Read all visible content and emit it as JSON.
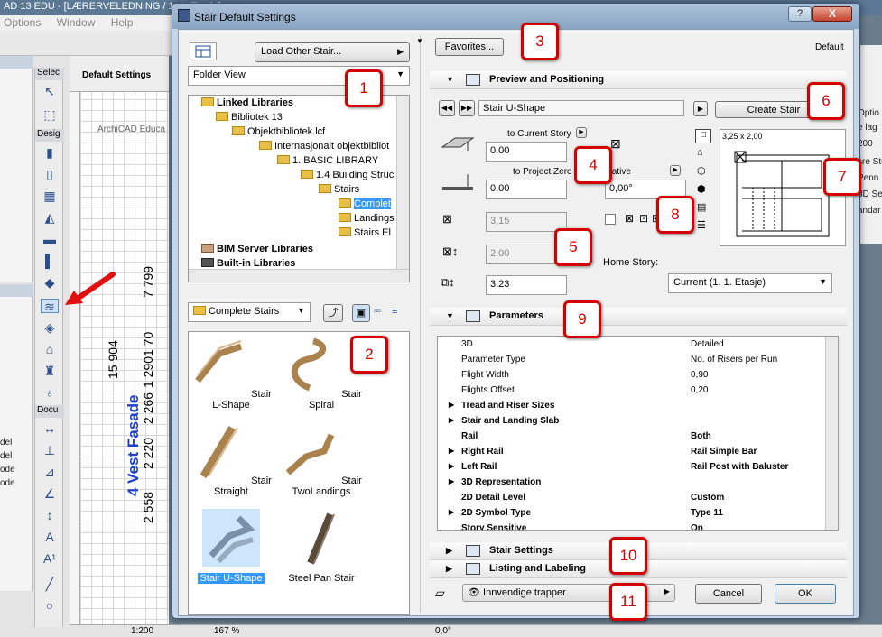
{
  "app": {
    "title": "AD 13 EDU - [LÆRERVELEDNING / 1. 1. Etasje]",
    "menu": [
      "Options",
      "Window",
      "Help"
    ],
    "toolbox_heads": [
      "Selec",
      "Desig",
      "Docu"
    ],
    "tab_label": "Default Settings",
    "tab_sub": "ArchiCAD Educa",
    "dims": [
      "7 799",
      "15 904",
      "2 558",
      "2 220",
      "2 266",
      "1 290",
      "1 70"
    ],
    "fasade": "4 Vest Fasade",
    "left_side": [
      "del",
      "del",
      "ode",
      "ode"
    ],
    "right_strip": [
      "Optio",
      "e lag",
      "200",
      "sre Stu",
      "Penn",
      "3D Se",
      "andar"
    ],
    "status": {
      "scale": "1:200",
      "zoom": "167 %",
      "angle": "0,0°"
    }
  },
  "dialog": {
    "title": "Stair Default Settings",
    "help": "?",
    "close": "X",
    "load_other": "Load Other Stair...",
    "folder_view": "Folder View",
    "favorites": "Favorites...",
    "default_label": "Default",
    "tree": {
      "linked": "Linked Libraries",
      "bib13": "Bibliotek 13",
      "obj": "Objektbibliotek.lcf",
      "intl": "Internasjonalt objektbibliot",
      "basic": "1. BASIC LIBRARY",
      "building": "1.4 Building Struc",
      "stairs": "Stairs",
      "complete": "Complet",
      "landings": "Landings",
      "stairs_el": "Stairs El",
      "bim": "BIM Server Libraries",
      "builtin": "Built-in Libraries"
    },
    "folder_select": "Complete Stairs",
    "gallery": [
      "Stair L-Shape",
      "Stair Spiral",
      "Stair Straight",
      "Stair TwoLandings",
      "Stair U-Shape",
      "Steel Pan Stair"
    ],
    "preview": {
      "title": "Preview and Positioning",
      "stair_name": "Stair U-Shape",
      "create_stair": "Create Stair",
      "to_current": "to Current Story",
      "val_current": "0,00",
      "to_project": "to Project Zero",
      "val_project": "0,00",
      "relative": "elative",
      "angle": "0,00°",
      "w": "3,15",
      "l": "2,00",
      "h": "3,23",
      "size_label": "3,25 x 2,00",
      "home_story_label": "Home Story:",
      "home_story": "Current (1. 1. Etasje)"
    },
    "parameters": {
      "title": "Parameters",
      "rows": [
        {
          "k": "3D",
          "v": "Detailed",
          "b": false,
          "t": false
        },
        {
          "k": "Parameter Type",
          "v": "No. of Risers per Run",
          "b": false,
          "t": false
        },
        {
          "k": "Flight Width",
          "v": "0,90",
          "b": false,
          "t": false
        },
        {
          "k": "Flights Offset",
          "v": "0,20",
          "b": false,
          "t": false
        },
        {
          "k": "Tread and Riser Sizes",
          "v": "",
          "b": true,
          "t": true
        },
        {
          "k": "Stair and Landing Slab",
          "v": "",
          "b": true,
          "t": true
        },
        {
          "k": "Rail",
          "v": "Both",
          "b": true,
          "t": false
        },
        {
          "k": "Right Rail",
          "v": "Rail Simple Bar",
          "b": true,
          "t": true
        },
        {
          "k": "Left Rail",
          "v": "Rail Post with Baluster",
          "b": true,
          "t": true
        },
        {
          "k": "3D Representation",
          "v": "",
          "b": true,
          "t": true
        },
        {
          "k": "2D Detail Level",
          "v": "Custom",
          "b": true,
          "t": false
        },
        {
          "k": "2D Symbol Type",
          "v": "Type 11",
          "b": true,
          "t": true
        },
        {
          "k": "Story Sensitive",
          "v": "On",
          "b": true,
          "t": false
        }
      ]
    },
    "stair_settings": "Stair Settings",
    "listing": "Listing and Labeling",
    "layer": "Innvendige trapper",
    "cancel": "Cancel",
    "ok": "OK"
  },
  "badges": [
    "1",
    "2",
    "3",
    "4",
    "5",
    "6",
    "7",
    "8",
    "9",
    "10",
    "11"
  ],
  "colors": {
    "badge": "#d40000",
    "selection": "#3399ff",
    "fasade": "#1a3fd0"
  }
}
